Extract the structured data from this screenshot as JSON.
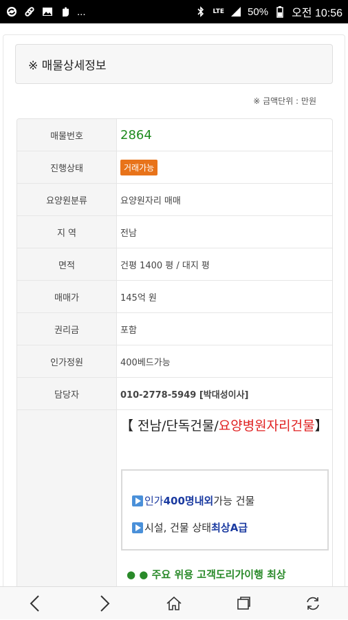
{
  "statusbar": {
    "ellipsis": "...",
    "network": "LTE",
    "battery": "50%",
    "time": "오전 10:56"
  },
  "title": "※ 매물상세정보",
  "unit_note": "※ 금액단위 : 만원",
  "rows": [
    {
      "label": "매물번호",
      "value": "2864"
    },
    {
      "label": "진행상태",
      "value": "거래가능"
    },
    {
      "label": "요양원분류",
      "value": "요양원자리 매매"
    },
    {
      "label": "지 역",
      "value": "전남"
    },
    {
      "label": "면적",
      "value": "건평 1400 평 / 대지 평"
    },
    {
      "label": "매매가",
      "value": "145억 원"
    },
    {
      "label": "권리금",
      "value": "포함"
    },
    {
      "label": "인가정원",
      "value": "400베드가능"
    },
    {
      "label": "담당자",
      "value": "010-2778-5949 [박대성이사]"
    }
  ],
  "description": {
    "headline_prefix": "【 전남/단독건물/",
    "headline_red": "요양병원자리건물",
    "headline_suffix": "】",
    "line1_a": "인가 ",
    "line1_b": "400명내외",
    "line1_c": " 가능 건물",
    "line2_a": "시설, 건물 상태 ",
    "line2_b": "최상A급",
    "partial": "● ● 주요 위용 고객도리가이행 최상"
  },
  "icons": {
    "back": "chevron-left-icon",
    "forward": "chevron-right-icon",
    "home": "home-icon",
    "tabs": "tabs-icon",
    "refresh": "refresh-icon"
  }
}
